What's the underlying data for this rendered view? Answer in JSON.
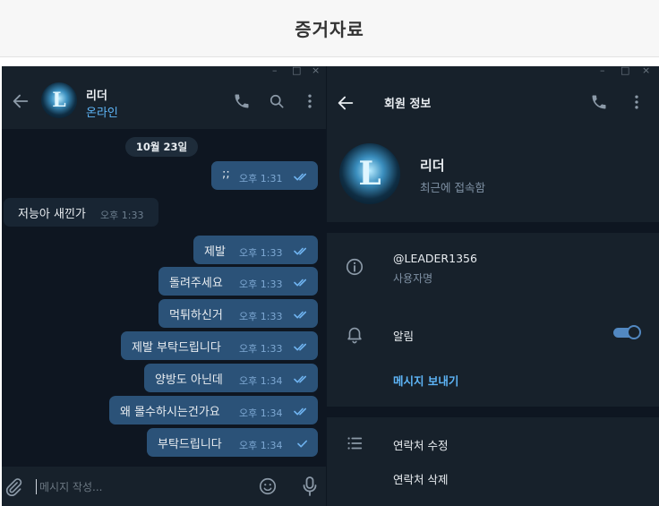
{
  "page": {
    "title": "증거자료"
  },
  "chat": {
    "name": "리더",
    "status": "온라인",
    "date": "10월 23일",
    "composer_placeholder": "메시지 작성...",
    "messages": [
      {
        "dir": "out",
        "text": ";;",
        "time": "오후 1:31",
        "check": "double"
      },
      {
        "dir": "in",
        "text": "저능아 새낀가",
        "time": "오후 1:33"
      },
      {
        "dir": "out",
        "text": "제발",
        "time": "오후 1:33",
        "check": "double"
      },
      {
        "dir": "out",
        "text": "돌려주세요",
        "time": "오후 1:33",
        "check": "double"
      },
      {
        "dir": "out",
        "text": "먹튀하신거",
        "time": "오후 1:33",
        "check": "double"
      },
      {
        "dir": "out",
        "text": "제발 부탁드립니다",
        "time": "오후 1:33",
        "check": "double"
      },
      {
        "dir": "out",
        "text": "양방도 아닌데",
        "time": "오후 1:34",
        "check": "double"
      },
      {
        "dir": "out",
        "text": "왜 몰수하시는건가요",
        "time": "오후 1:34",
        "check": "double"
      },
      {
        "dir": "out",
        "text": "부탁드립니다",
        "time": "오후 1:34",
        "check": "single"
      }
    ]
  },
  "profile": {
    "title": "회원 정보",
    "name": "리더",
    "last_seen": "최근에 접속함",
    "username": "@LEADER1356",
    "username_label": "사용자명",
    "notifications_label": "알림",
    "notifications_on": true,
    "send_message": "메시지 보내기",
    "edit_contact": "연락처 수정",
    "delete_contact": "연락처 삭제"
  },
  "colors": {
    "chat_bg": "#0e1621",
    "panel_bg": "#17212b",
    "outgoing_bubble": "#2b5278",
    "incoming_bubble": "#182533",
    "accent": "#5eb5f7"
  },
  "icons": [
    "back-arrow-icon",
    "phone-icon",
    "search-icon",
    "more-icon",
    "attach-icon",
    "emoji-icon",
    "mic-icon",
    "info-icon",
    "bell-icon",
    "list-icon",
    "double-check-icon",
    "check-icon"
  ]
}
